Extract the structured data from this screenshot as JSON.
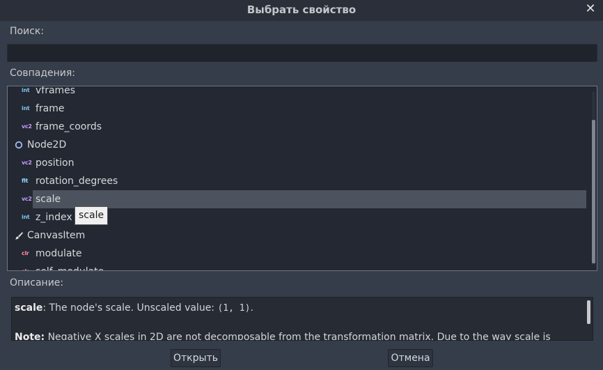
{
  "dialog": {
    "title": "Выбрать свойство"
  },
  "search": {
    "label": "Поиск:",
    "value": ""
  },
  "matches": {
    "label": "Совпадения:",
    "rows": [
      {
        "type": "prop",
        "badge": "int",
        "text": "vframes"
      },
      {
        "type": "prop",
        "badge": "int",
        "text": "frame"
      },
      {
        "type": "prop",
        "badge": "vc2",
        "text": "frame_coords"
      },
      {
        "type": "group",
        "icon": "node2d-icon",
        "text": "Node2D"
      },
      {
        "type": "prop",
        "badge": "vc2",
        "text": "position"
      },
      {
        "type": "prop",
        "badge": "flt",
        "text": "rotation_degrees"
      },
      {
        "type": "prop",
        "badge": "vc2",
        "text": "scale",
        "selected": true
      },
      {
        "type": "prop",
        "badge": "int",
        "text": "z_index"
      },
      {
        "type": "group",
        "icon": "canvasitem-brush-icon",
        "text": "CanvasItem"
      },
      {
        "type": "prop",
        "badge": "clr",
        "text": "modulate"
      },
      {
        "type": "prop",
        "badge": "clr",
        "text": "self_modulate"
      }
    ]
  },
  "tooltip": {
    "text": "scale"
  },
  "description": {
    "label": "Описание:",
    "line1_name": "scale",
    "line1_text": ": The node's scale. Unscaled value: ",
    "line1_code": "(1, 1)",
    "line1_end": ".",
    "line2_name": "Note:",
    "line2_text": " Negative X scales in 2D are not decomposable from the transformation matrix. Due to the way scale is"
  },
  "buttons": {
    "open": "Открыть",
    "cancel": "Отмена"
  },
  "colors": {
    "selection": "#4d535e",
    "background": "#363d4a",
    "int_badge": "#7dc1f0",
    "vc2_badge": "#c49dff",
    "flt_badge": "#8fd9ff",
    "clr_badge": "#f8899a"
  }
}
